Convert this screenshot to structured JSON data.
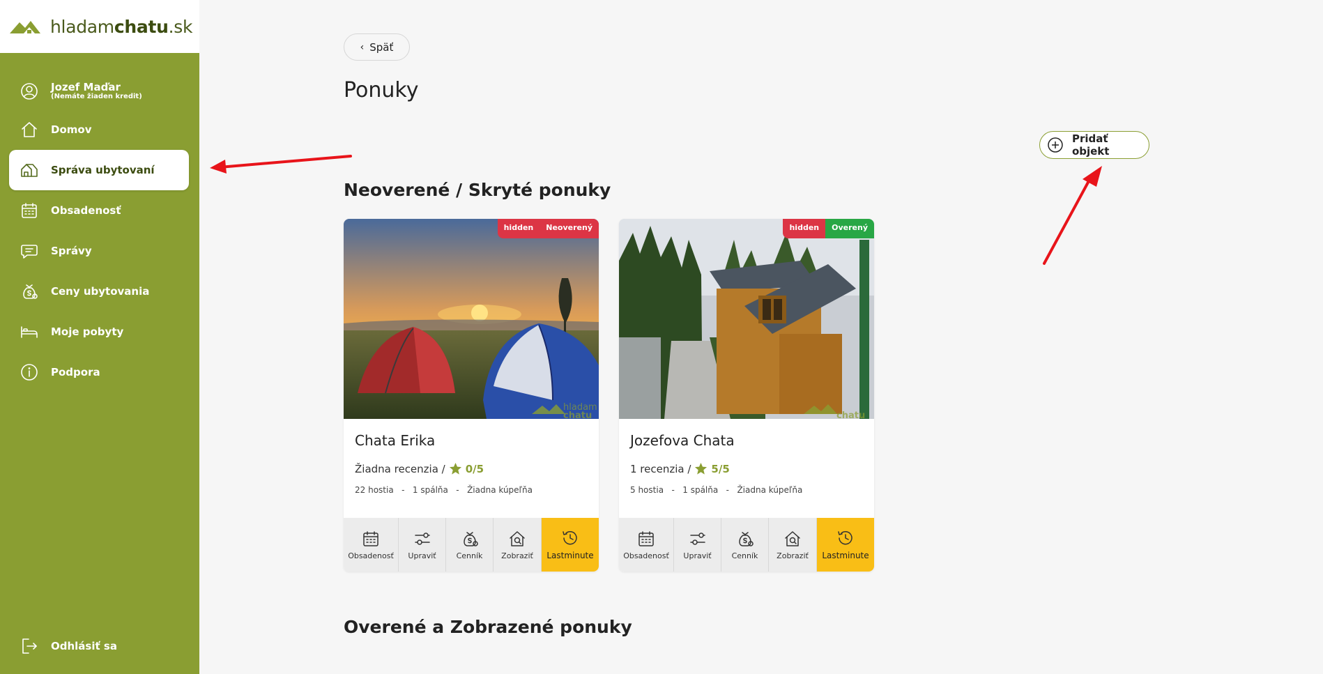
{
  "brand": {
    "logo_part1": "hladam",
    "logo_part2": "chatu",
    "logo_part3": ".sk",
    "accent": "#8a9e32"
  },
  "sidebar": {
    "user": {
      "name": "Jozef Maďar",
      "credit": "(Nemáte žiaden kredit)",
      "icon": "user-icon"
    },
    "items": [
      {
        "label": "Domov",
        "icon": "home-icon"
      },
      {
        "label": "Správa ubytovaní",
        "icon": "houses-icon",
        "active": true
      },
      {
        "label": "Obsadenosť",
        "icon": "calendar-icon"
      },
      {
        "label": "Správy",
        "icon": "message-icon"
      },
      {
        "label": "Ceny ubytovania",
        "icon": "money-bag-icon"
      },
      {
        "label": "Moje pobyty",
        "icon": "bed-icon"
      },
      {
        "label": "Podpora",
        "icon": "info-icon"
      }
    ],
    "logout": {
      "label": "Odhlásiť sa",
      "icon": "logout-icon"
    }
  },
  "main": {
    "back_label": "Späť",
    "title": "Ponuky",
    "add_label": "Pridať objekt",
    "section_unverified": "Neoverené / Skryté ponuky",
    "section_verified": "Overené a Zobrazené ponuky",
    "cards": [
      {
        "title": "Chata Erika",
        "badge1": "hidden",
        "badge2": "Neoverený",
        "badge2_color": "#dc3545",
        "review_text": "Žiadna recenzia /",
        "rating": "0/5",
        "meta": "22 hostia   -   1 spálňa   -   Žiadna kúpeľňa",
        "image": "tents-at-sunset"
      },
      {
        "title": "Jozefova Chata",
        "badge1": "hidden",
        "badge2": "Overený",
        "badge2_color": "#28a745",
        "review_text": "1 recenzia /",
        "rating": "5/5",
        "meta": "5 hostia   -   1 spálňa   -   Žiadna kúpeľňa",
        "image": "wooden-cottage"
      }
    ],
    "actions": [
      {
        "label": "Obsadenosť",
        "icon": "calendar-icon"
      },
      {
        "label": "Upraviť",
        "icon": "sliders-icon"
      },
      {
        "label": "Cenník",
        "icon": "money-bag-icon"
      },
      {
        "label": "Zobraziť",
        "icon": "house-search-icon"
      },
      {
        "label": "Lastminute",
        "icon": "clock-history-icon"
      }
    ]
  }
}
